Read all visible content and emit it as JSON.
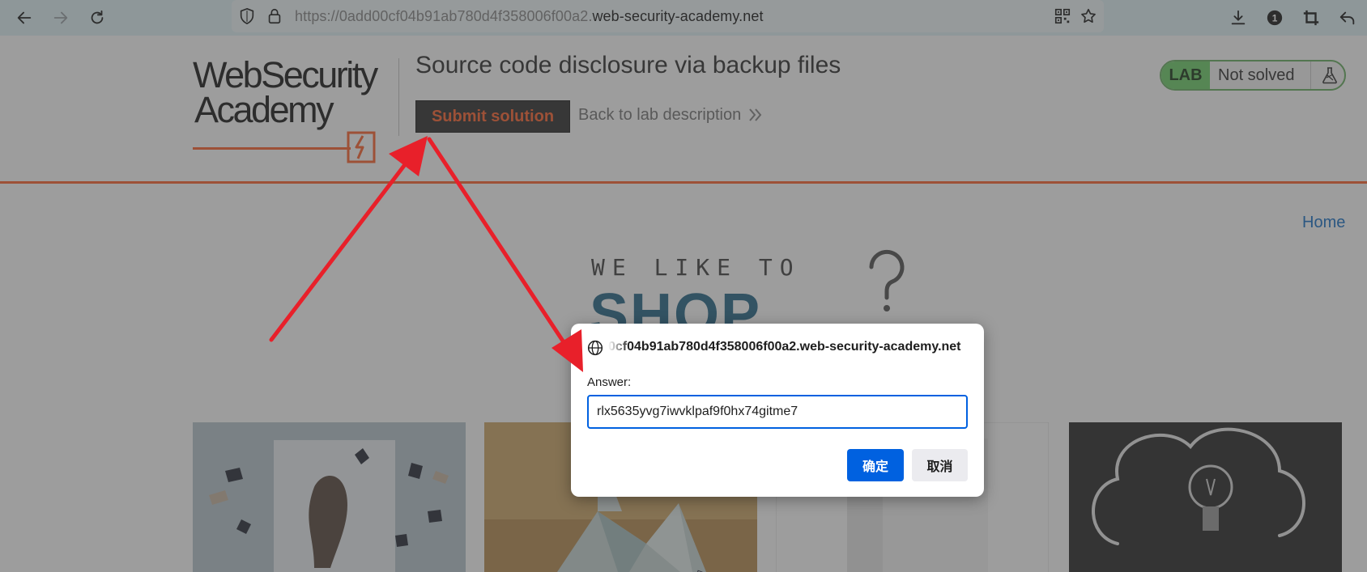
{
  "browser": {
    "url_prefix": "https://0add00cf04b91ab780d4f358006f00a2.",
    "url_domain": "web-security-academy.net",
    "icons": [
      "back-arrow-icon",
      "forward-arrow-icon",
      "reload-icon",
      "shield-icon",
      "lock-icon",
      "qr-code-icon",
      "star-icon",
      "download-icon",
      "extension-badge-icon",
      "crop-icon",
      "undo-icon"
    ],
    "badge_count": "1"
  },
  "header": {
    "logo_line1": "WebSecurity",
    "logo_line2": "Academy",
    "lab_title": "Source code disclosure via backup files",
    "submit_label": "Submit solution",
    "back_label": "Back to lab description",
    "status_tag": "LAB",
    "status_text": "Not solved"
  },
  "nav": {
    "home_label": "Home"
  },
  "hero": {
    "tagline_top": "WE LIKE TO",
    "tagline_big": "SHOP"
  },
  "dialog": {
    "origin": "0cf04b91ab780d4f358006f00a2.web-security-academy.net",
    "answer_label": "Answer:",
    "answer_value": "rlx5635yvg7iwvklpaf9f0hx74gitme7",
    "ok_label": "确定",
    "cancel_label": "取消"
  },
  "colors": {
    "accent": "#ff6633",
    "toolbar": "#e1f2f6",
    "primary_button": "#0061e0",
    "annotation_arrow": "#e8202a",
    "lab_green": "#70d16d"
  }
}
